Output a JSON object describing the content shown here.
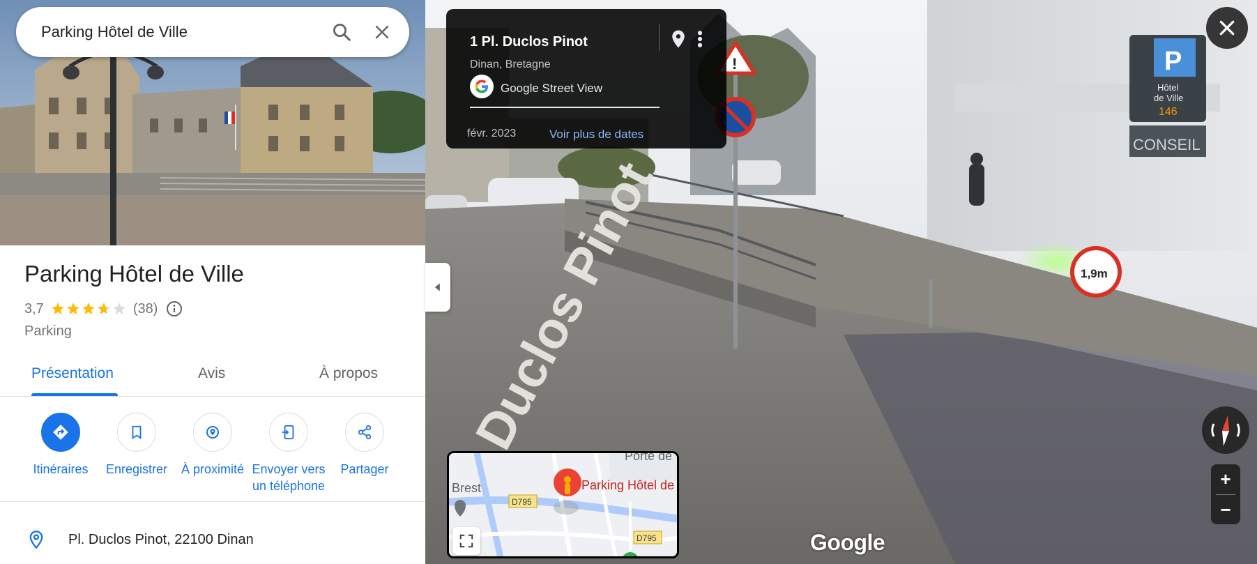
{
  "search": {
    "value": "Parking Hôtel de Ville"
  },
  "place": {
    "title": "Parking Hôtel de Ville",
    "rating": "3,7",
    "stars": 3.7,
    "reviews": "(38)",
    "category": "Parking"
  },
  "tabs": [
    {
      "label": "Présentation"
    },
    {
      "label": "Avis"
    },
    {
      "label": "À propos"
    }
  ],
  "actions": [
    {
      "label": "Itinéraires"
    },
    {
      "label": "Enregistrer"
    },
    {
      "label": "À proximité"
    },
    {
      "label": "Envoyer vers un téléphone"
    },
    {
      "label": "Partager"
    }
  ],
  "address": {
    "text": "Pl. Duclos Pinot, 22100 Dinan"
  },
  "streetview": {
    "title": "1 Pl. Duclos Pinot",
    "subtitle": "Dinan, Bretagne",
    "source": "Google Street View",
    "date": "févr. 2023",
    "more_dates": "Voir plus de dates",
    "street_name": "Duclos Pinot",
    "watermark": "Google",
    "sign_parking_line1": "Hôtel",
    "sign_parking_line2": "de Ville",
    "sign_parking_count": "146",
    "sign_height": "1,9m",
    "sign_shop": "CONSEIL"
  },
  "minimap": {
    "place_label": "Parking Hôtel de",
    "city": "Brest",
    "road1": "D795",
    "road2": "D795",
    "area": "Porte de"
  },
  "colors": {
    "accent": "#1a73e8",
    "star": "#fbbc04",
    "pin": "#ea4335",
    "card_link": "#8ab4f8"
  }
}
